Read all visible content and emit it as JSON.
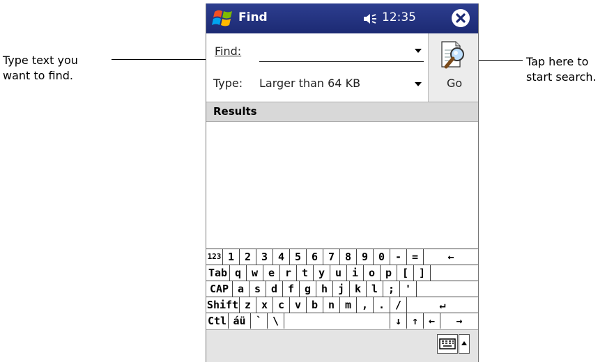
{
  "annotations": {
    "left_line1": "Type text you",
    "left_line2": "want to find.",
    "right_line1": "Tap here to",
    "right_line2": "start search."
  },
  "titlebar": {
    "app_title": "Find",
    "time": "12:35",
    "start_icon": "windows-flag-icon",
    "volume_icon": "speaker-icon",
    "close_icon": "close-icon"
  },
  "form": {
    "find_label": "Find:",
    "find_value": "",
    "type_label": "Type:",
    "type_value": "Larger than 64 KB",
    "go_label": "Go",
    "go_icon": "magnifier-document-icon"
  },
  "results": {
    "header": "Results",
    "items": []
  },
  "keyboard": {
    "rows": [
      [
        "123",
        "1",
        "2",
        "3",
        "4",
        "5",
        "6",
        "7",
        "8",
        "9",
        "0",
        "-",
        "=",
        "←"
      ],
      [
        "Tab",
        "q",
        "w",
        "e",
        "r",
        "t",
        "y",
        "u",
        "i",
        "o",
        "p",
        "[",
        "]"
      ],
      [
        "CAP",
        "a",
        "s",
        "d",
        "f",
        "g",
        "h",
        "j",
        "k",
        "l",
        ";",
        "'"
      ],
      [
        "Shift",
        "z",
        "x",
        "c",
        "v",
        "b",
        "n",
        "m",
        ",",
        ".",
        "/",
        "↵"
      ],
      [
        "Ctl",
        "áü",
        "`",
        "\\",
        " ",
        "↓",
        "↑",
        "←",
        "→"
      ]
    ]
  },
  "menubar": {
    "sip_icon": "keyboard-icon",
    "sip_arrow_icon": "up-arrow-icon"
  }
}
